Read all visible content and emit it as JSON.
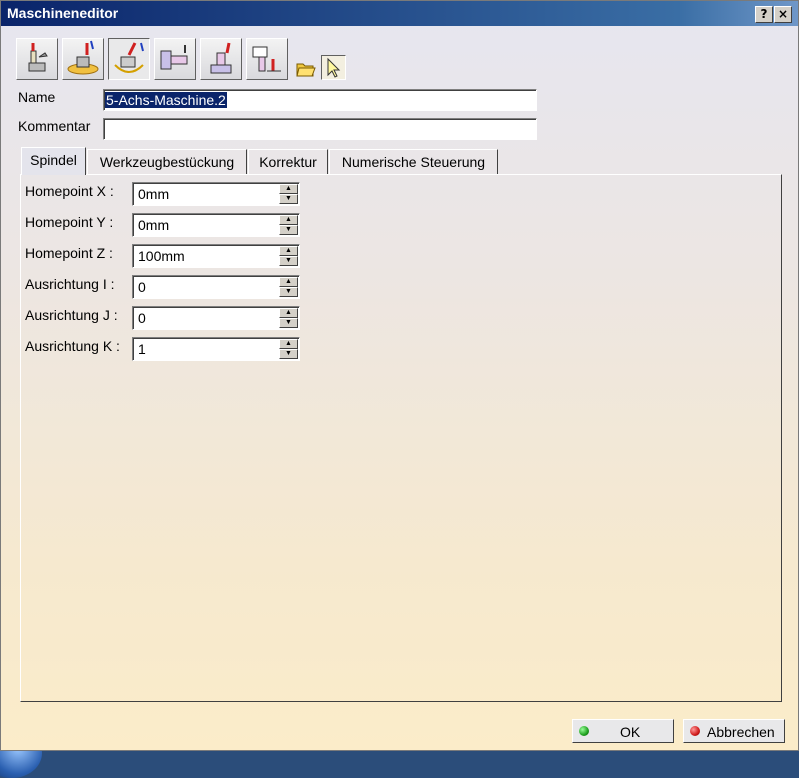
{
  "window": {
    "title": "Maschineneditor",
    "help_label": "?",
    "close_label": "×"
  },
  "toolbar": {
    "tools": [
      "3-axis-machine-icon",
      "3-axis-rotary-table-icon",
      "5-axis-machine-icon",
      "horizontal-lathe-icon",
      "vertical-lathe-icon",
      "multi-slide-lathe-icon"
    ],
    "open_icon": "folder-open-icon",
    "select_icon": "select-arrow-icon"
  },
  "form": {
    "name_label": "Name",
    "name_value": "5-Achs-Maschine.2",
    "comment_label": "Kommentar",
    "comment_value": ""
  },
  "tabs": [
    "Spindel",
    "Werkzeugbestückung",
    "Korrektur",
    "Numerische Steuerung"
  ],
  "spindle": {
    "fields": [
      {
        "label": "Homepoint X :",
        "value": "0mm"
      },
      {
        "label": "Homepoint Y :",
        "value": "0mm"
      },
      {
        "label": "Homepoint Z :",
        "value": "100mm"
      },
      {
        "label": "Ausrichtung I :",
        "value": "0"
      },
      {
        "label": "Ausrichtung J :",
        "value": "0"
      },
      {
        "label": "Ausrichtung K :",
        "value": "1"
      }
    ]
  },
  "buttons": {
    "ok": "OK",
    "cancel": "Abbrechen"
  },
  "colors": {
    "ok_dot": "#1fa01f",
    "cancel_dot": "#d01a1a",
    "title_bar": "#0a246a"
  }
}
